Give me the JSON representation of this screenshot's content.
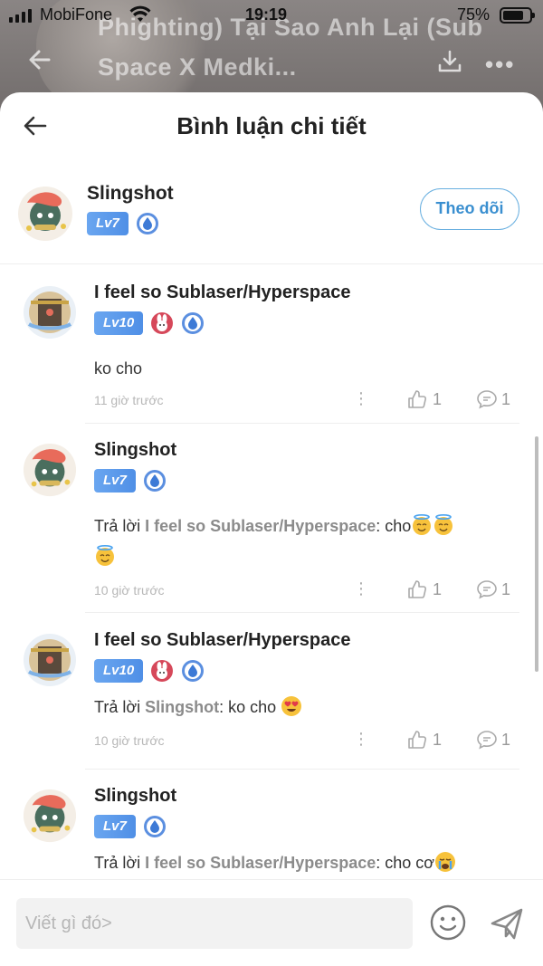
{
  "status_bar": {
    "carrier": "MobiFone",
    "time": "19:19",
    "battery": "75%"
  },
  "background_page": {
    "title": "Phighting) Tại Sao Anh Lại (Sub Space X Medki..."
  },
  "sheet": {
    "title": "Bình luận chi tiết"
  },
  "author": {
    "name": "Slingshot",
    "level": "Lv7",
    "follow_label": "Theo dõi"
  },
  "comments": [
    {
      "name": "I feel so Sublaser/Hyperspace",
      "level": "Lv10",
      "has_bunny_badge": true,
      "text_prefix": "",
      "mention": "",
      "text": "ko cho",
      "time": "11 giờ trước",
      "likes": "1",
      "replies": "1"
    },
    {
      "name": "Slingshot",
      "level": "Lv7",
      "has_bunny_badge": false,
      "text_prefix": "Trả lời ",
      "mention": "I feel so Sublaser/Hyperspace",
      "text": ": cho",
      "time": "10 giờ trước",
      "likes": "1",
      "replies": "1"
    },
    {
      "name": "I feel so Sublaser/Hyperspace",
      "level": "Lv10",
      "has_bunny_badge": true,
      "text_prefix": "Trả lời ",
      "mention": "Slingshot",
      "text": ": ko cho ",
      "time": "10 giờ trước",
      "likes": "1",
      "replies": "1"
    },
    {
      "name": "Slingshot",
      "level": "Lv7",
      "has_bunny_badge": false,
      "text_prefix": "Trả lời ",
      "mention": "I feel so Sublaser/Hyperspace",
      "text": ": cho cơ",
      "time": "",
      "likes": "",
      "replies": ""
    }
  ],
  "composer": {
    "placeholder": "Viết gì đó>"
  },
  "colors": {
    "accent": "#3a8fd0",
    "level_badge": "#5b9be9",
    "mention": "#8b8b8b"
  }
}
